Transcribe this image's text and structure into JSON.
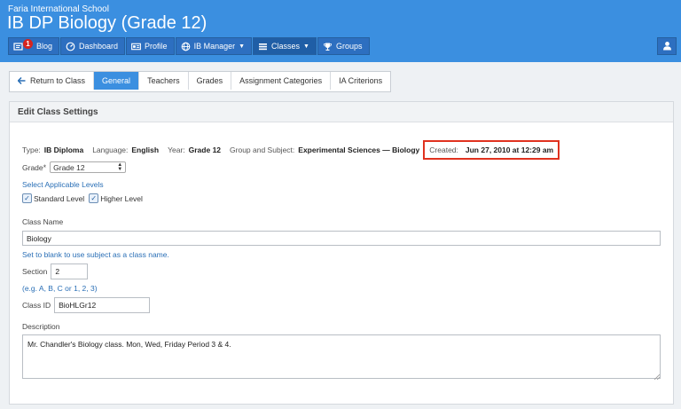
{
  "header": {
    "school": "Faria International School",
    "title": "IB DP Biology (Grade 12)"
  },
  "nav": {
    "blog": "Blog",
    "blog_badge": "1",
    "dashboard": "Dashboard",
    "profile": "Profile",
    "ib_manager": "IB Manager",
    "classes": "Classes",
    "groups": "Groups"
  },
  "subtabs": {
    "return": "Return to Class",
    "general": "General",
    "teachers": "Teachers",
    "grades": "Grades",
    "assignment_categories": "Assignment Categories",
    "ia_criterions": "IA Criterions"
  },
  "panel": {
    "title": "Edit Class Settings"
  },
  "info": {
    "type_label": "Type:",
    "type_value": "IB Diploma",
    "language_label": "Language:",
    "language_value": "English",
    "year_label": "Year:",
    "year_value": "Grade 12",
    "group_label": "Group and Subject:",
    "group_value": "Experimental Sciences — Biology",
    "created_label": "Created:",
    "created_value": "Jun 27, 2010 at 12:29 am"
  },
  "form": {
    "grade_label": "Grade",
    "grade_required": "*",
    "grade_value": "Grade 12",
    "levels_link": "Select Applicable Levels",
    "standard_level": "Standard Level",
    "higher_level": "Higher Level",
    "class_name_label": "Class Name",
    "class_name_value": "Biology",
    "class_name_hint": "Set to blank to use subject as a class name.",
    "section_label": "Section",
    "section_value": "2",
    "section_hint": "(e.g. A, B, C or 1, 2, 3)",
    "class_id_label": "Class ID",
    "class_id_value": "BioHLGr12",
    "description_label": "Description",
    "description_value": "Mr. Chandler's Biology class. Mon, Wed, Friday Period 3 & 4."
  },
  "colors": {
    "header_blue": "#3b8fe0",
    "nav_button": "#2d6fc0",
    "highlight_red": "#e0321f",
    "link_blue": "#2a6fb6"
  },
  "icons": {
    "blog": "blog-icon",
    "dashboard": "dashboard-icon",
    "profile": "profile-card-icon",
    "ib_manager": "globe-icon",
    "classes": "list-icon",
    "groups": "trophy-icon",
    "user": "user-icon",
    "return": "back-arrow-icon"
  }
}
